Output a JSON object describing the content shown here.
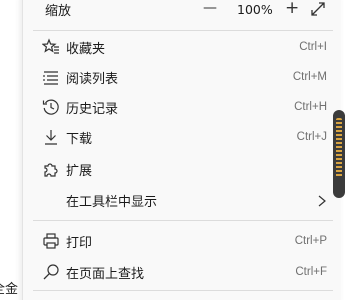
{
  "background": {
    "peek_text": "全金"
  },
  "zoom": {
    "label": "缩放",
    "minus": "—",
    "value": "100%",
    "plus": "+",
    "fullscreen_icon": "expand-icon"
  },
  "items": [
    {
      "label": "收藏夹",
      "shortcut": "Ctrl+I",
      "icon": "favorites-icon"
    },
    {
      "label": "阅读列表",
      "shortcut": "Ctrl+M",
      "icon": "reading-list-icon"
    },
    {
      "label": "历史记录",
      "shortcut": "Ctrl+H",
      "icon": "history-icon"
    },
    {
      "label": "下载",
      "shortcut": "Ctrl+J",
      "icon": "download-icon"
    },
    {
      "label": "扩展",
      "shortcut": "",
      "icon": "extensions-icon"
    },
    {
      "label": "在工具栏中显示",
      "shortcut": "",
      "icon": ""
    },
    {
      "label": "打印",
      "shortcut": "Ctrl+P",
      "icon": "print-icon"
    },
    {
      "label": "在页面上查找",
      "shortcut": "Ctrl+F",
      "icon": "find-icon"
    }
  ],
  "colors": {
    "menu_bg": "#f9f9f9",
    "divider": "#dcdcdc",
    "text": "#1b1b1b",
    "shortcut": "#707070"
  }
}
